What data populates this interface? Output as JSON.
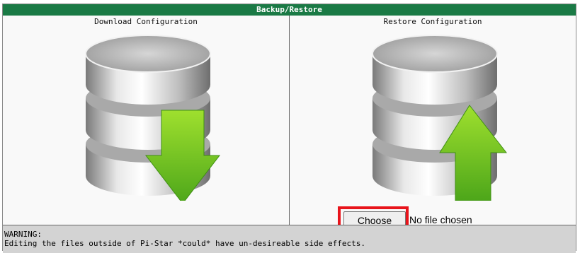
{
  "panel": {
    "title": "Backup/Restore"
  },
  "download": {
    "label": "Download Configuration",
    "icon": "database-download-icon"
  },
  "restore": {
    "label": "Restore Configuration",
    "icon": "database-upload-icon",
    "choose_file_label": "Choose File",
    "file_status": "No file chosen"
  },
  "warning": {
    "heading": "WARNING:",
    "text": "Editing the files outside of Pi-Star *could* have un-desireable side effects."
  },
  "colors": {
    "title_bar": "#1a7a45",
    "highlight": "#e8141b",
    "arrow_green": "#6cc21e"
  }
}
